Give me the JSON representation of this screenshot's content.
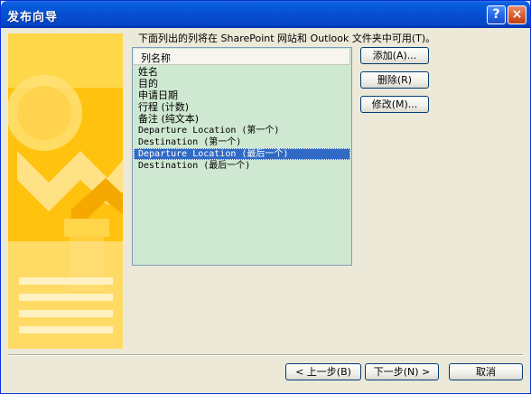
{
  "window": {
    "title": "发布向导",
    "help_icon": "?",
    "close_icon": "×"
  },
  "instructions": "下面列出的列将在 SharePoint 网站和 Outlook 文件夹中可用(T)。",
  "list": {
    "header": "列名称",
    "items": [
      "姓名",
      "目的",
      "申请日期",
      "行程 (计数)",
      "备注 (纯文本)",
      "Departure Location (第一个)",
      "Destination (第一个)",
      "Departure Location (最后一个)",
      "Destination (最后一个)"
    ],
    "selected_index": 7
  },
  "side_buttons": {
    "add": "添加(A)...",
    "delete": "删除(R)",
    "modify": "修改(M)..."
  },
  "footer": {
    "back": "< 上一步(B)",
    "next": "下一步(N) >",
    "cancel": "取消"
  },
  "colors": {
    "title_bar": "#0553d4",
    "list_bg": "#cfe8d2",
    "selection": "#316ac5",
    "art_orange": "#ffbf00"
  }
}
